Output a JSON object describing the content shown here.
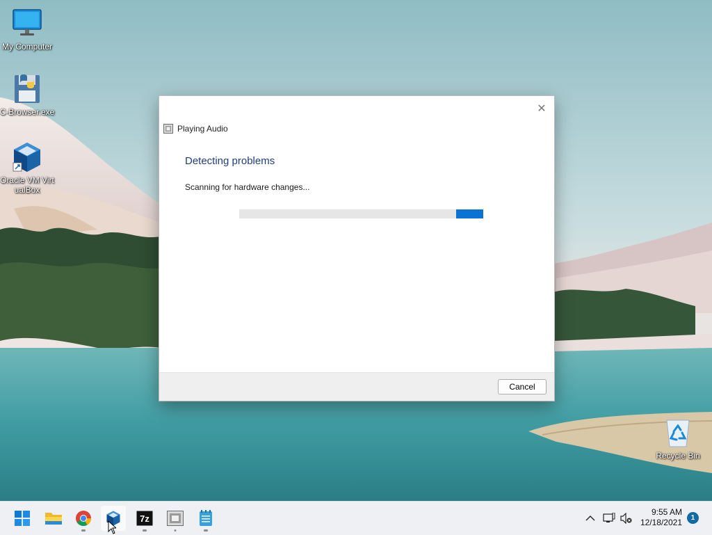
{
  "desktop": {
    "icons": [
      {
        "label": "My Computer",
        "icon": "monitor-icon"
      },
      {
        "label": "C-Browser.exe",
        "icon": "python-floppy-icon"
      },
      {
        "label": "Oracle VM VirtualBox",
        "icon": "virtualbox-icon"
      },
      {
        "label": "Recycle Bin",
        "icon": "recycle-bin-icon"
      }
    ]
  },
  "dialog": {
    "title": "Playing Audio",
    "heading": "Detecting problems",
    "status": "Scanning for hardware changes...",
    "cancel_label": "Cancel",
    "close_glyph": "✕",
    "accent_color": "#0a73d3"
  },
  "taskbar": {
    "apps": [
      {
        "name": "start-icon"
      },
      {
        "name": "file-explorer-icon"
      },
      {
        "name": "chrome-icon"
      },
      {
        "name": "virtualbox-icon"
      },
      {
        "name": "7zip-icon",
        "label": "7z"
      },
      {
        "name": "troubleshooter-icon"
      },
      {
        "name": "notepad-icon"
      }
    ],
    "tray": {
      "chevron": "^",
      "time": "9:55 AM",
      "date": "12/18/2021",
      "notification_count": "1"
    }
  }
}
